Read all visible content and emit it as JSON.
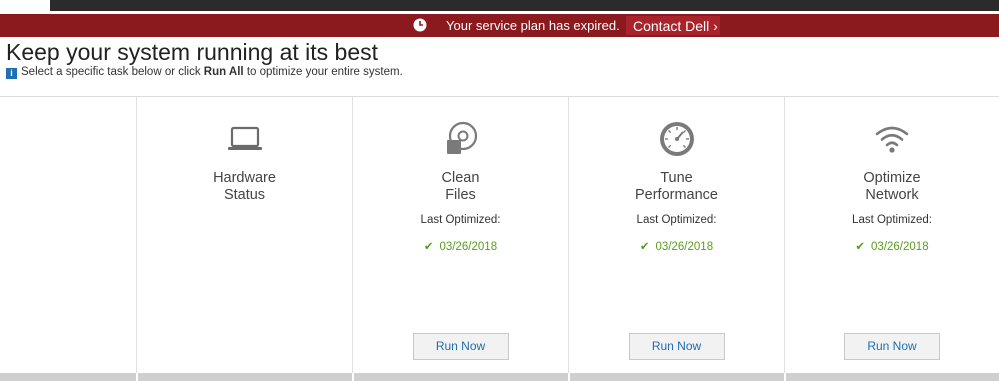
{
  "alert": {
    "message": "Your service plan has expired.",
    "contact_label": "Contact Dell",
    "contact_arrow": "›"
  },
  "header": {
    "title": "Keep your system running at its best",
    "info_glyph": "i",
    "subtitle_before": "Select a specific task below or click ",
    "subtitle_bold": "Run All",
    "subtitle_after": " to optimize your entire system."
  },
  "tasks": [
    {
      "line1": "Hardware",
      "line2": "Status",
      "icon": "laptop-icon"
    },
    {
      "line1": "Clean",
      "line2": "Files",
      "icon": "clean-files-icon",
      "last_label": "Last Optimized:",
      "date": "03/26/2018",
      "run_label": "Run Now"
    },
    {
      "line1": "Tune",
      "line2": "Performance",
      "icon": "gauge-icon",
      "last_label": "Last Optimized:",
      "date": "03/26/2018",
      "run_label": "Run Now"
    },
    {
      "line1": "Optimize",
      "line2": "Network",
      "icon": "wifi-icon",
      "last_label": "Last Optimized:",
      "date": "03/26/2018",
      "run_label": "Run Now"
    }
  ],
  "colors": {
    "alert_bg": "#8b1a1f",
    "accent_blue": "#1f6fb2",
    "success_green": "#5a9c1e"
  }
}
